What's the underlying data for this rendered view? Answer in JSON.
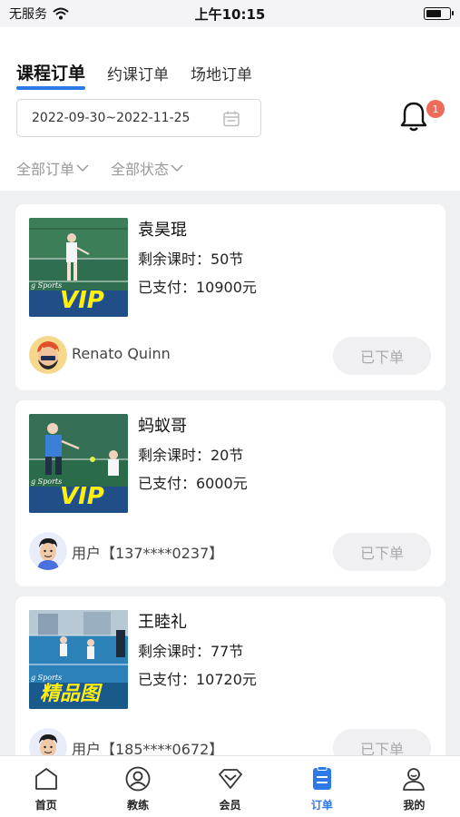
{
  "status_bar": {
    "carrier": "无服务",
    "time": "上午10:15",
    "battery_level": 0.65
  },
  "tabs": [
    {
      "label": "课程订单",
      "active": true
    },
    {
      "label": "约课订单",
      "active": false
    },
    {
      "label": "场地订单",
      "active": false
    }
  ],
  "date_range": {
    "value": "2022-09-30~2022-11-25",
    "icon": "calendar-icon"
  },
  "notifications": {
    "badge_count": "1",
    "icon": "bell-icon"
  },
  "filters": [
    {
      "label": "全部订单"
    },
    {
      "label": "全部状态"
    }
  ],
  "orders": [
    {
      "name": "袁昊琨",
      "remaining": "剩余课时：50节",
      "paid": "已支付：10900元",
      "thumb_tag": "VIP",
      "thumb_text": "g Sports",
      "user": "Renato Quinn",
      "status": "已下单"
    },
    {
      "name": "蚂蚁哥",
      "remaining": "剩余课时：20节",
      "paid": "已支付：6000元",
      "thumb_tag": "VIP",
      "thumb_text": "g Sports",
      "user": "用户【137****0237】",
      "status": "已下单"
    },
    {
      "name": "王睦礼",
      "remaining": "剩余课时：77节",
      "paid": "已支付：10720元",
      "thumb_tag": "精品图",
      "thumb_text": "g Sports",
      "user": "用户【185****0672】",
      "status": "已下单"
    }
  ],
  "bottom_nav": [
    {
      "label": "首页",
      "icon": "home-icon",
      "active": false
    },
    {
      "label": "教练",
      "icon": "coach-icon",
      "active": false
    },
    {
      "label": "会员",
      "icon": "member-icon",
      "active": false
    },
    {
      "label": "订单",
      "icon": "order-icon",
      "active": true
    },
    {
      "label": "我的",
      "icon": "profile-icon",
      "active": false
    }
  ],
  "colors": {
    "accent": "#2e79e8",
    "badge": "#f06a5a",
    "background": "#eff0f2"
  }
}
